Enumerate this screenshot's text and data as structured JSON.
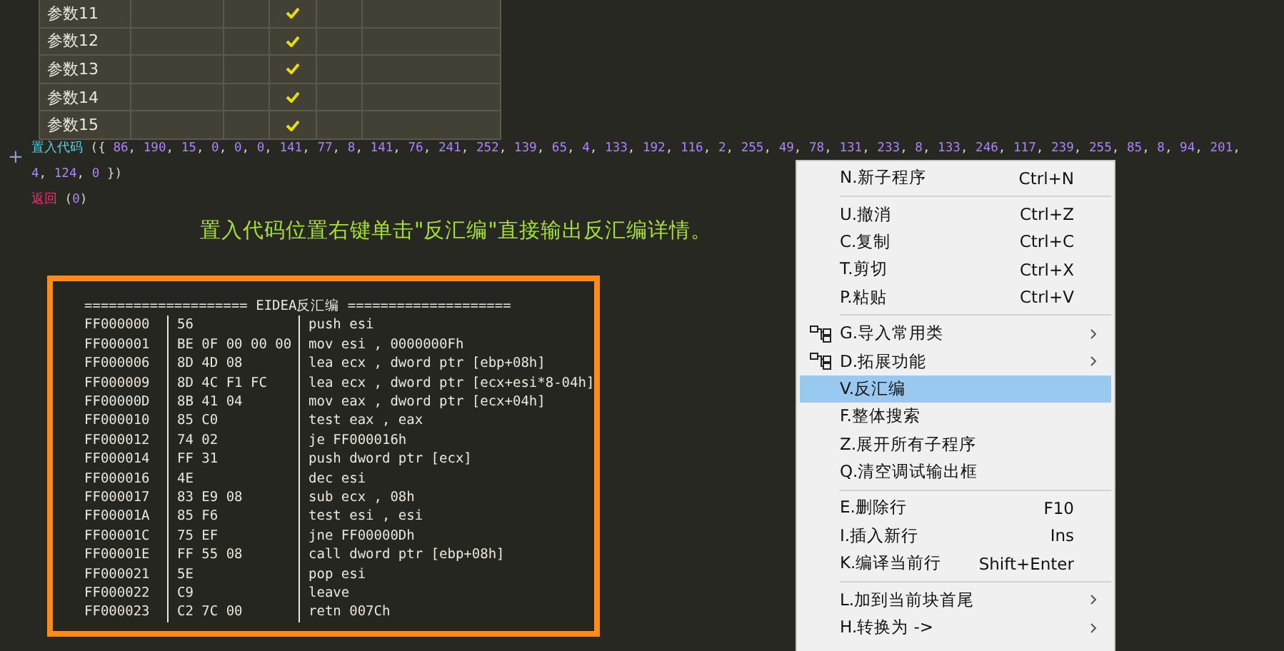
{
  "params_table": {
    "rows": [
      {
        "name": "参数11",
        "checked": true
      },
      {
        "name": "参数12",
        "checked": true
      },
      {
        "name": "参数13",
        "checked": true
      },
      {
        "name": "参数14",
        "checked": true
      },
      {
        "name": "参数15",
        "checked": true
      }
    ]
  },
  "code": {
    "gutter_marker": "+",
    "lines": [
      {
        "kind": "call",
        "keyword": "置入代码",
        "args": [
          "({ 86, 190, 15, 0, 0, 0, 141, 77, 8, 141, 76, 241, 252, 139, 65, 4, 133, 192, 116, 2, 255, 49, 78, 131, 233, 8, 133, 246, 117, 239, 255, 85, 8, 94, 201,",
          "4, 124, 0 })"
        ]
      },
      {
        "kind": "return",
        "keyword": "返回",
        "args": [
          "(0)"
        ]
      }
    ]
  },
  "annotation": "置入代码位置右键单击\"反汇编\"直接输出反汇编详情。",
  "disassembly": {
    "header": "==================== EIDEA反汇编 ====================",
    "rows": [
      {
        "address": "FF000000",
        "bytes": "56",
        "instruction": "push esi"
      },
      {
        "address": "FF000001",
        "bytes": "BE 0F 00 00 00",
        "instruction": "mov esi , 0000000Fh"
      },
      {
        "address": "FF000006",
        "bytes": "8D 4D 08",
        "instruction": "lea ecx , dword ptr [ebp+08h]"
      },
      {
        "address": "FF000009",
        "bytes": "8D 4C F1 FC",
        "instruction": "lea ecx , dword ptr [ecx+esi*8-04h]"
      },
      {
        "address": "FF00000D",
        "bytes": "8B 41 04",
        "instruction": "mov eax , dword ptr [ecx+04h]"
      },
      {
        "address": "FF000010",
        "bytes": "85 C0",
        "instruction": "test eax , eax"
      },
      {
        "address": "FF000012",
        "bytes": "74 02",
        "instruction": "je FF000016h"
      },
      {
        "address": "FF000014",
        "bytes": "FF 31",
        "instruction": "push dword ptr [ecx]"
      },
      {
        "address": "FF000016",
        "bytes": "4E",
        "instruction": "dec esi"
      },
      {
        "address": "FF000017",
        "bytes": "83 E9 08",
        "instruction": "sub ecx , 08h"
      },
      {
        "address": "FF00001A",
        "bytes": "85 F6",
        "instruction": "test esi , esi"
      },
      {
        "address": "FF00001C",
        "bytes": "75 EF",
        "instruction": "jne FF00000Dh"
      },
      {
        "address": "FF00001E",
        "bytes": "FF 55 08",
        "instruction": "call dword ptr [ebp+08h]"
      },
      {
        "address": "FF000021",
        "bytes": "5E",
        "instruction": "pop esi"
      },
      {
        "address": "FF000022",
        "bytes": "C9",
        "instruction": "leave"
      },
      {
        "address": "FF000023",
        "bytes": "C2 7C 00",
        "instruction": "retn 007Ch"
      }
    ]
  },
  "context_menu": {
    "items": [
      {
        "kind": "item",
        "label": "N.新子程序",
        "shortcut": "Ctrl+N",
        "icon": false,
        "submenu": false,
        "selected": false
      },
      {
        "kind": "separator"
      },
      {
        "kind": "item",
        "label": "U.撤消",
        "shortcut": "Ctrl+Z",
        "icon": false,
        "submenu": false,
        "selected": false
      },
      {
        "kind": "item",
        "label": "C.复制",
        "shortcut": "Ctrl+C",
        "icon": false,
        "submenu": false,
        "selected": false
      },
      {
        "kind": "item",
        "label": "T.剪切",
        "shortcut": "Ctrl+X",
        "icon": false,
        "submenu": false,
        "selected": false
      },
      {
        "kind": "item",
        "label": "P.粘贴",
        "shortcut": "Ctrl+V",
        "icon": false,
        "submenu": false,
        "selected": false
      },
      {
        "kind": "separator"
      },
      {
        "kind": "item",
        "label": "G.导入常用类",
        "icon": true,
        "submenu": true,
        "selected": false
      },
      {
        "kind": "item",
        "label": "D.拓展功能",
        "icon": true,
        "submenu": true,
        "selected": false
      },
      {
        "kind": "item",
        "label": "V.反汇编",
        "icon": false,
        "submenu": false,
        "selected": true
      },
      {
        "kind": "item",
        "label": "F.整体搜索",
        "icon": false,
        "submenu": false,
        "selected": false
      },
      {
        "kind": "item",
        "label": "Z.展开所有子程序",
        "icon": false,
        "submenu": false,
        "selected": false
      },
      {
        "kind": "item",
        "label": "Q.清空调试输出框",
        "icon": false,
        "submenu": false,
        "selected": false
      },
      {
        "kind": "separator"
      },
      {
        "kind": "item",
        "label": "E.删除行",
        "shortcut": "F10",
        "icon": false,
        "submenu": false,
        "selected": false
      },
      {
        "kind": "item",
        "label": "I.插入新行",
        "shortcut": "Ins",
        "icon": false,
        "submenu": false,
        "selected": false
      },
      {
        "kind": "item",
        "label": "K.编译当前行",
        "shortcut": "Shift+Enter",
        "icon": false,
        "submenu": false,
        "selected": false
      },
      {
        "kind": "separator"
      },
      {
        "kind": "item",
        "label": "L.加到当前块首尾",
        "icon": false,
        "submenu": true,
        "selected": false
      },
      {
        "kind": "item",
        "label": "H.转换为 ->",
        "icon": false,
        "submenu": true,
        "selected": false
      }
    ]
  }
}
